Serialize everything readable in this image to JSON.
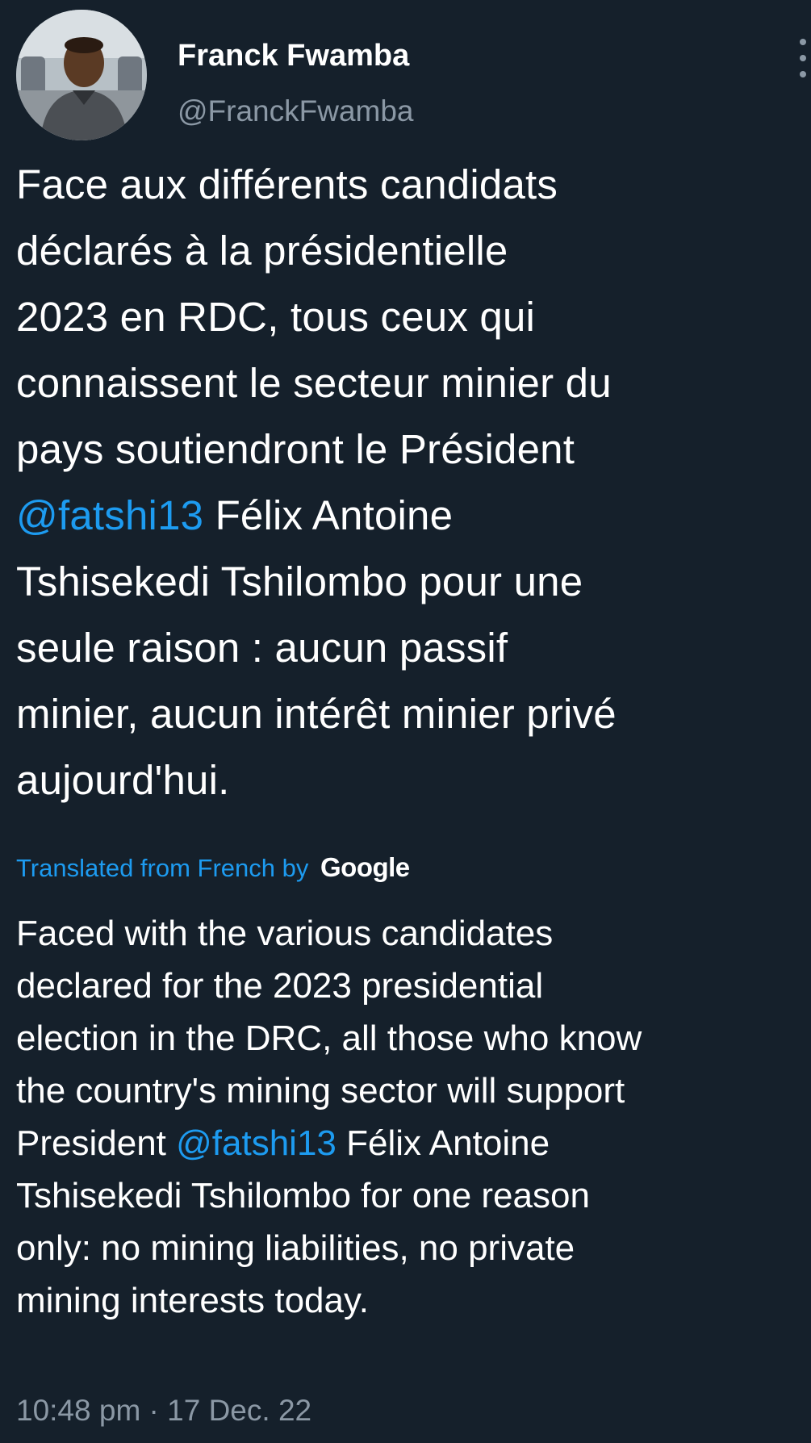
{
  "author": {
    "name": "Franck Fwamba",
    "handle": "@FranckFwamba"
  },
  "tweet": {
    "lines": [
      {
        "text": "Face aux différents candidats"
      },
      {
        "text": "déclarés à la présidentielle"
      },
      {
        "text": "2023 en RDC, tous ceux qui"
      },
      {
        "text": "connaissent le secteur minier du"
      },
      {
        "text": "pays soutiendront le Président"
      },
      {
        "mention": "@fatshi13",
        "text": " Félix Antoine"
      },
      {
        "text": "Tshisekedi Tshilombo pour une"
      },
      {
        "text": "seule raison : aucun passif"
      },
      {
        "text": "minier, aucun intérêt minier privé"
      },
      {
        "text": "aujourd'hui."
      }
    ]
  },
  "translation": {
    "label": "Translated from French by",
    "provider": "Google",
    "lines": [
      {
        "text": "Faced with the various candidates"
      },
      {
        "text": "declared for the 2023 presidential"
      },
      {
        "text": "election in the DRC, all those who know"
      },
      {
        "text": "the country's mining sector will support"
      },
      {
        "prefix": "President ",
        "mention": "@fatshi13",
        "text": " Félix Antoine"
      },
      {
        "text": "Tshisekedi Tshilombo for one reason"
      },
      {
        "text": "only: no mining liabilities, no private"
      },
      {
        "text": "mining interests today."
      }
    ]
  },
  "timestamp": "10:48 pm · 17 Dec. 22",
  "colors": {
    "background": "#15202b",
    "text": "#ffffff",
    "secondary": "#8b98a5",
    "accent": "#1d9bf0"
  },
  "icons": {
    "more": "more-vertical-icon",
    "avatar": "profile-photo"
  }
}
